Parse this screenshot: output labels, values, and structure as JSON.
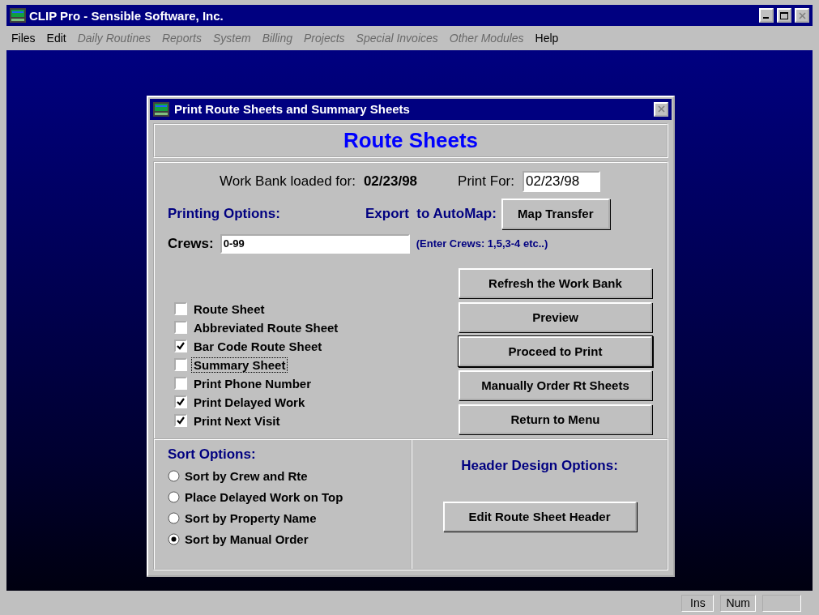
{
  "window": {
    "title": "CLIP Pro - Sensible Software, Inc."
  },
  "menu": [
    {
      "label": "Files",
      "disabled": false
    },
    {
      "label": "Edit",
      "disabled": false
    },
    {
      "label": "Daily Routines",
      "disabled": true
    },
    {
      "label": "Reports",
      "disabled": true
    },
    {
      "label": "System",
      "disabled": true
    },
    {
      "label": "Billing",
      "disabled": true
    },
    {
      "label": "Projects",
      "disabled": true
    },
    {
      "label": "Special Invoices",
      "disabled": true
    },
    {
      "label": "Other Modules",
      "disabled": true
    },
    {
      "label": "Help",
      "disabled": false
    }
  ],
  "dialog": {
    "title": "Print Route Sheets and Summary Sheets",
    "heading": "Route Sheets",
    "work_bank_label": "Work Bank loaded for:",
    "work_bank_date": "02/23/98",
    "print_for_label": "Print For:",
    "print_for_value": "02/23/98",
    "printing_options_label": "Printing Options:",
    "export_label": "Export  to AutoMap:",
    "map_transfer_button": "Map Transfer",
    "crews_label": "Crews:",
    "crews_value": "0-99",
    "crews_hint": "(Enter Crews: 1,5,3-4 etc..)",
    "options": [
      {
        "label": "Route Sheet",
        "checked": false,
        "focused": false
      },
      {
        "label": "Abbreviated Route Sheet",
        "checked": false,
        "focused": false
      },
      {
        "label": "Bar Code Route Sheet",
        "checked": true,
        "focused": false
      },
      {
        "label": "Summary Sheet",
        "checked": false,
        "focused": true
      },
      {
        "label": "Print Phone Number",
        "checked": false,
        "focused": false
      },
      {
        "label": "Print Delayed Work",
        "checked": true,
        "focused": false
      },
      {
        "label": "Print Next Visit",
        "checked": true,
        "focused": false
      }
    ],
    "buttons": [
      {
        "label": "Refresh the Work Bank",
        "default": false
      },
      {
        "label": "Preview",
        "default": false
      },
      {
        "label": "Proceed to Print",
        "default": true
      },
      {
        "label": "Manually Order Rt Sheets",
        "default": false
      },
      {
        "label": "Return to Menu",
        "default": false
      }
    ],
    "sort_label": "Sort Options:",
    "sort_options": [
      {
        "label": "Sort by Crew and Rte",
        "selected": false
      },
      {
        "label": "Place Delayed Work on Top",
        "selected": false
      },
      {
        "label": "Sort by Property Name",
        "selected": false
      },
      {
        "label": "Sort by Manual Order",
        "selected": true
      }
    ],
    "header_label": "Header Design Options:",
    "header_button": "Edit Route Sheet Header"
  },
  "status_bar": [
    "Ins",
    "Num"
  ]
}
